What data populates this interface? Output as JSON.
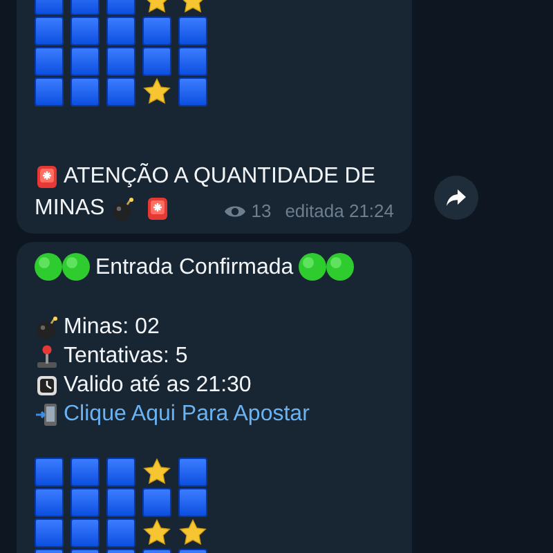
{
  "messages": [
    {
      "grid": [
        [
          {
            "kind": "square"
          },
          {
            "kind": "square"
          },
          {
            "kind": "square"
          },
          {
            "kind": "star"
          },
          {
            "kind": "star"
          }
        ],
        [
          {
            "kind": "square"
          },
          {
            "kind": "square"
          },
          {
            "kind": "square"
          },
          {
            "kind": "square"
          },
          {
            "kind": "square"
          }
        ],
        [
          {
            "kind": "square"
          },
          {
            "kind": "square"
          },
          {
            "kind": "square"
          },
          {
            "kind": "square"
          },
          {
            "kind": "square"
          }
        ],
        [
          {
            "kind": "square"
          },
          {
            "kind": "square"
          },
          {
            "kind": "square"
          },
          {
            "kind": "star"
          },
          {
            "kind": "square"
          }
        ]
      ],
      "lines": [
        {
          "icons": [
            {
              "kind": "siren"
            }
          ],
          "text": "ATENÇÃO A QUANTIDADE DE",
          "kind": "text"
        },
        {
          "text": "MINAS",
          "after": [
            {
              "kind": "bomb"
            },
            {
              "kind": "siren"
            }
          ],
          "kind": "text"
        }
      ],
      "views": "13",
      "edited": "editada 21:24",
      "share": true
    },
    {
      "title": {
        "text": "Entrada Confirmada",
        "icons": [
          {
            "kind": "circle"
          },
          {
            "kind": "circle"
          }
        ]
      },
      "lines": [
        {
          "icons": [
            {
              "kind": "bomb"
            }
          ],
          "text": "Minas: 02",
          "kind": "text"
        },
        {
          "icons": [
            {
              "kind": "joystick"
            }
          ],
          "text": "Tentativas: 5",
          "kind": "text"
        },
        {
          "icons": [
            {
              "kind": "watch"
            }
          ],
          "text": "Valido até as 21:30",
          "kind": "text"
        },
        {
          "icons": [
            {
              "kind": "phone"
            }
          ],
          "text": "Clique Aqui Para Apostar",
          "kind": "link"
        }
      ],
      "grid_after": [
        [
          {
            "kind": "square"
          },
          {
            "kind": "square"
          },
          {
            "kind": "square"
          },
          {
            "kind": "star"
          },
          {
            "kind": "square"
          }
        ],
        [
          {
            "kind": "square"
          },
          {
            "kind": "square"
          },
          {
            "kind": "square"
          },
          {
            "kind": "square"
          },
          {
            "kind": "square"
          }
        ],
        [
          {
            "kind": "square"
          },
          {
            "kind": "square"
          },
          {
            "kind": "square"
          },
          {
            "kind": "star"
          },
          {
            "kind": "star"
          }
        ],
        [
          {
            "kind": "square"
          },
          {
            "kind": "square"
          },
          {
            "kind": "square"
          },
          {
            "kind": "square"
          },
          {
            "kind": "square"
          }
        ]
      ]
    }
  ]
}
